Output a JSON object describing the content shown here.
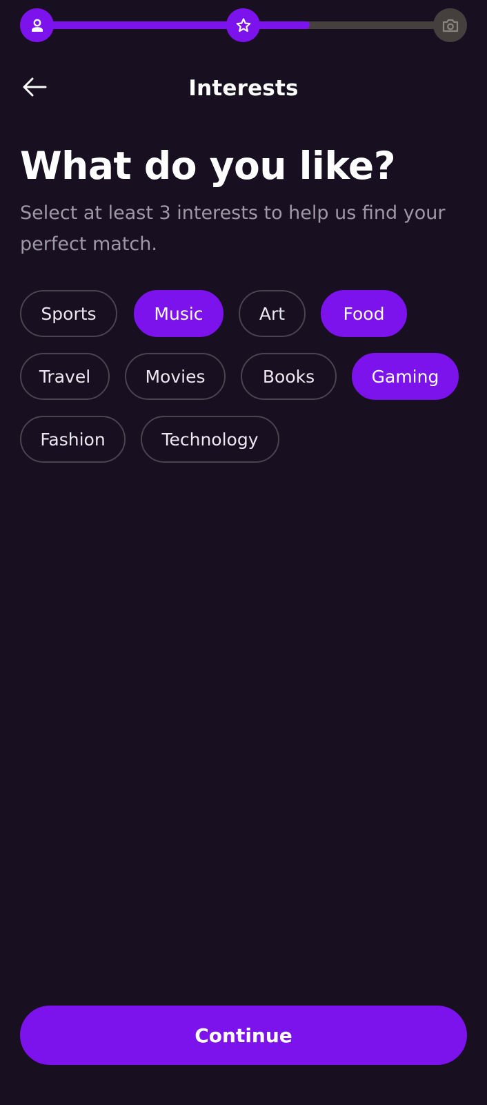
{
  "progress": {
    "fill_fraction": 0.66,
    "steps": [
      {
        "icon": "person-icon",
        "state": "done"
      },
      {
        "icon": "star-icon",
        "state": "done"
      },
      {
        "icon": "camera-icon",
        "state": "todo"
      }
    ]
  },
  "header": {
    "title": "Interests",
    "back_icon": "arrow-left-icon"
  },
  "main": {
    "headline": "What do you like?",
    "subtitle": "Select at least 3 interests to help us find your perfect match."
  },
  "interests": [
    {
      "label": "Sports",
      "selected": false
    },
    {
      "label": "Music",
      "selected": true
    },
    {
      "label": "Art",
      "selected": false
    },
    {
      "label": "Food",
      "selected": true
    },
    {
      "label": "Travel",
      "selected": false
    },
    {
      "label": "Movies",
      "selected": false
    },
    {
      "label": "Books",
      "selected": false
    },
    {
      "label": "Gaming",
      "selected": true
    },
    {
      "label": "Fashion",
      "selected": false
    },
    {
      "label": "Technology",
      "selected": false
    }
  ],
  "footer": {
    "continue_label": "Continue"
  },
  "colors": {
    "background": "#181020",
    "accent": "#7c12ec",
    "inactive": "#45403e",
    "chip_border": "#4a4450",
    "muted_text": "#9e99a6"
  }
}
